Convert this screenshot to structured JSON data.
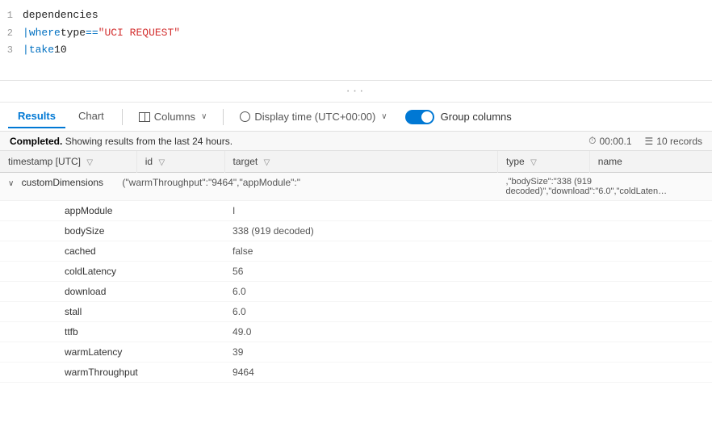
{
  "editor": {
    "lines": [
      {
        "num": 1,
        "parts": [
          {
            "text": "dependencies",
            "class": "code-text"
          }
        ]
      },
      {
        "num": 2,
        "parts": [
          {
            "text": "| ",
            "class": "kw-pipe"
          },
          {
            "text": "where ",
            "class": "kw-blue"
          },
          {
            "text": "type",
            "class": "code-text"
          },
          {
            "text": " == ",
            "class": "op-blue"
          },
          {
            "text": "\"UCI REQUEST\"",
            "class": "str-red"
          }
        ]
      },
      {
        "num": 3,
        "parts": [
          {
            "text": "| ",
            "class": "kw-pipe"
          },
          {
            "text": "take ",
            "class": "kw-blue"
          },
          {
            "text": "10",
            "class": "code-text"
          }
        ]
      }
    ]
  },
  "tabs": {
    "items": [
      "Results",
      "Chart"
    ],
    "active": "Results"
  },
  "toolbar": {
    "columns_label": "Columns",
    "display_time_label": "Display time (UTC+00:00)",
    "group_columns_label": "Group columns"
  },
  "status": {
    "text": "Completed.",
    "sub_text": " Showing results from the last 24 hours.",
    "time": "00:00.1",
    "records": "10 records"
  },
  "table": {
    "headers": [
      "timestamp [UTC]",
      "id",
      "target",
      "type",
      "name"
    ],
    "expand_row": {
      "label": "customDimensions",
      "target_preview": "(\"warmThroughput\":\"9464\",\"appModule\":\"",
      "right_preview": ",\"bodySize\":\"338 (919 decoded)\",\"download\":\"6.0\",\"coldLaten…"
    },
    "nested_rows": [
      {
        "label": "appModule",
        "value": "I"
      },
      {
        "label": "bodySize",
        "value": "338 (919 decoded)"
      },
      {
        "label": "cached",
        "value": "false"
      },
      {
        "label": "coldLatency",
        "value": "56"
      },
      {
        "label": "download",
        "value": "6.0"
      },
      {
        "label": "stall",
        "value": "6.0"
      },
      {
        "label": "ttfb",
        "value": "49.0"
      },
      {
        "label": "warmLatency",
        "value": "39"
      },
      {
        "label": "warmThroughput",
        "value": "9464"
      }
    ]
  },
  "icons": {
    "filter": "▽",
    "chevron_down": "∨",
    "chevron_right": "›",
    "expand_down": "∨",
    "clock": "⏱",
    "calendar": "☰",
    "dots": "···"
  }
}
